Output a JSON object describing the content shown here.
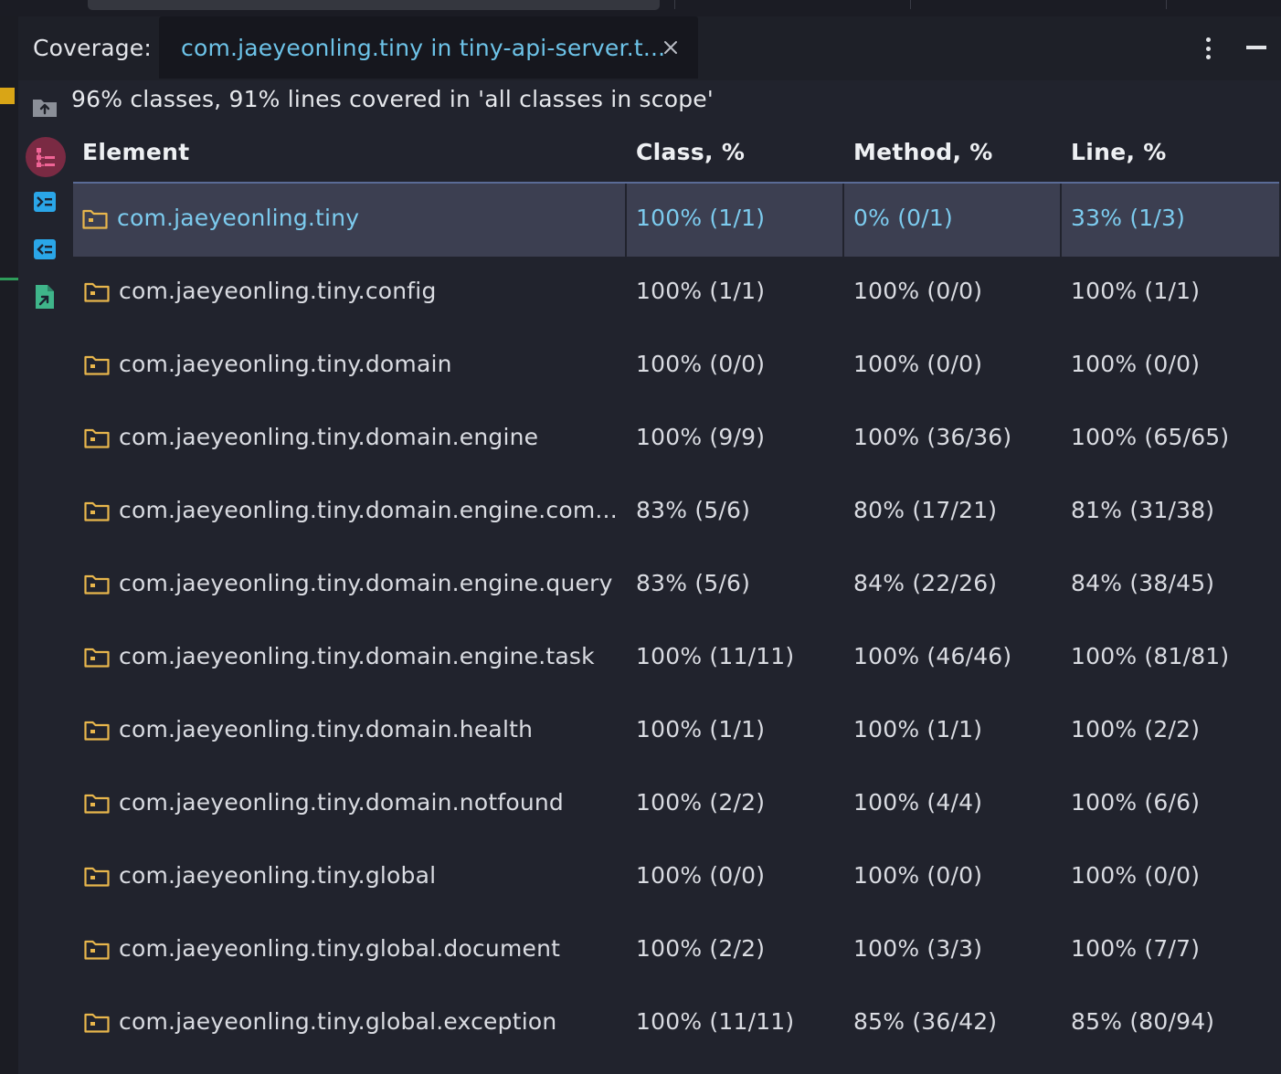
{
  "header": {
    "title": "Coverage:",
    "tab_label": "com.jaeyeonling.tiny in tiny-api-server.t..."
  },
  "summary": "96% classes, 91% lines covered in 'all classes in scope'",
  "table": {
    "columns": [
      "Element",
      "Class, %",
      "Method, %",
      "Line, %"
    ],
    "rows": [
      {
        "element": "com.jaeyeonling.tiny",
        "class": "100% (1/1)",
        "method": "0% (0/1)",
        "line": "33% (1/3)"
      },
      {
        "element": "com.jaeyeonling.tiny.config",
        "class": "100% (1/1)",
        "method": "100% (0/0)",
        "line": "100% (1/1)"
      },
      {
        "element": "com.jaeyeonling.tiny.domain",
        "class": "100% (0/0)",
        "method": "100% (0/0)",
        "line": "100% (0/0)"
      },
      {
        "element": "com.jaeyeonling.tiny.domain.engine",
        "class": "100% (9/9)",
        "method": "100% (36/36)",
        "line": "100% (65/65)"
      },
      {
        "element": "com.jaeyeonling.tiny.domain.engine.com...",
        "class": "83% (5/6)",
        "method": "80% (17/21)",
        "line": "81% (31/38)"
      },
      {
        "element": "com.jaeyeonling.tiny.domain.engine.query",
        "class": "83% (5/6)",
        "method": "84% (22/26)",
        "line": "84% (38/45)"
      },
      {
        "element": "com.jaeyeonling.tiny.domain.engine.task",
        "class": "100% (11/11)",
        "method": "100% (46/46)",
        "line": "100% (81/81)"
      },
      {
        "element": "com.jaeyeonling.tiny.domain.health",
        "class": "100% (1/1)",
        "method": "100% (1/1)",
        "line": "100% (2/2)"
      },
      {
        "element": "com.jaeyeonling.tiny.domain.notfound",
        "class": "100% (2/2)",
        "method": "100% (4/4)",
        "line": "100% (6/6)"
      },
      {
        "element": "com.jaeyeonling.tiny.global",
        "class": "100% (0/0)",
        "method": "100% (0/0)",
        "line": "100% (0/0)"
      },
      {
        "element": "com.jaeyeonling.tiny.global.document",
        "class": "100% (2/2)",
        "method": "100% (3/3)",
        "line": "100% (7/7)"
      },
      {
        "element": "com.jaeyeonling.tiny.global.exception",
        "class": "100% (11/11)",
        "method": "85% (36/42)",
        "line": "85% (80/94)"
      }
    ]
  },
  "toolbar_icons": [
    "go-up-folder-icon",
    "flatten-packages-icon",
    "navigate-to-source-icon",
    "navigate-from-source-icon",
    "export-report-icon"
  ],
  "colors": {
    "background": "#21232d",
    "selected_row": "#3c3f51",
    "selected_text": "#7ccbee",
    "tab_text": "#6dc3e8",
    "folder_icon": "#e8b64c",
    "accent_marker": "#d9a516"
  }
}
